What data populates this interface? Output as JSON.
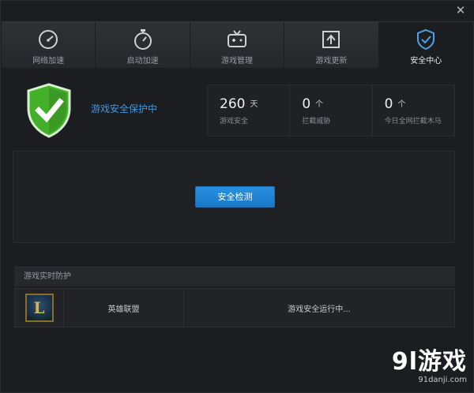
{
  "window": {
    "close_glyph": "✕"
  },
  "tabs": [
    {
      "label": "网络加速",
      "icon": "speedometer-icon",
      "active": false
    },
    {
      "label": "启动加速",
      "icon": "stopwatch-icon",
      "active": false
    },
    {
      "label": "游戏管理",
      "icon": "gamepad-icon",
      "active": false
    },
    {
      "label": "游戏更新",
      "icon": "update-icon",
      "active": false
    },
    {
      "label": "安全中心",
      "icon": "shield-check-icon",
      "active": true
    }
  ],
  "protection": {
    "status": "游戏安全保护中"
  },
  "stats": [
    {
      "value": "260",
      "unit": "天",
      "label": "游戏安全"
    },
    {
      "value": "0",
      "unit": "个",
      "label": "拦截威胁"
    },
    {
      "value": "0",
      "unit": "个",
      "label": "今日全网拦截木马"
    }
  ],
  "scan": {
    "button_label": "安全检测"
  },
  "realtime": {
    "header": "游戏实时防护",
    "games": [
      {
        "icon_letter": "L",
        "name": "英雄联盟",
        "status": "游戏安全运行中..."
      }
    ]
  },
  "watermark": {
    "main": "9l游戏",
    "sub": "91danji.com"
  },
  "colors": {
    "accent": "#3f98e0",
    "button": "#1f82d6",
    "shield": "#43b02a"
  }
}
